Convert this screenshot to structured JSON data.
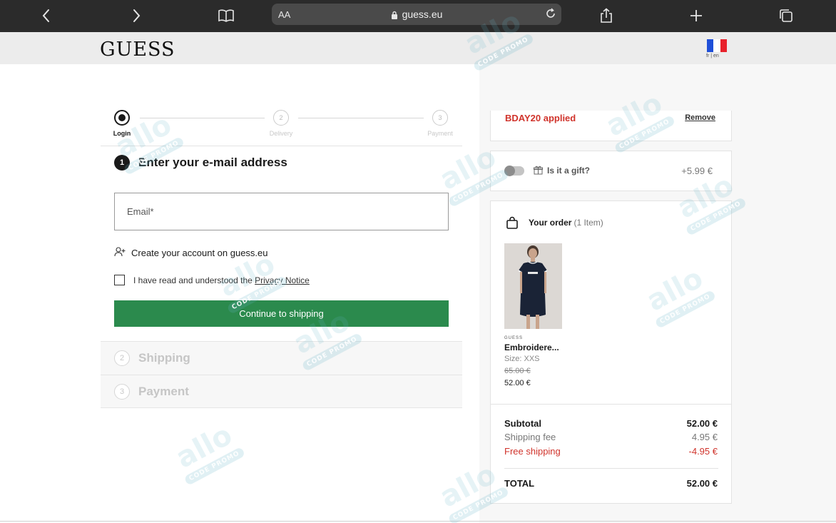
{
  "browser": {
    "aa_label": "AA",
    "url": "guess.eu"
  },
  "header": {
    "logo": "GUESS",
    "flag_colors": [
      "#1f4fd8",
      "#ffffff",
      "#e8212b"
    ],
    "language": "fr | en"
  },
  "stepper": {
    "steps": [
      {
        "number": "",
        "label": "Login"
      },
      {
        "number": "2",
        "label": "Delivery"
      },
      {
        "number": "3",
        "label": "Payment"
      }
    ]
  },
  "login": {
    "number": "1",
    "title": "Enter your e-mail address",
    "email_placeholder": "Email*",
    "create_account": "Create your account on guess.eu",
    "privacy_prefix": "I have read and understood the",
    "privacy_link": "Privacy Notice",
    "continue_label": "Continue to shipping",
    "continue_color": "#2b8a4d"
  },
  "sections": [
    {
      "number": "2",
      "title": "Shipping"
    },
    {
      "number": "3",
      "title": "Payment"
    }
  ],
  "promo": {
    "code_text": "BDAY20 applied",
    "remove_label": "Remove"
  },
  "gift": {
    "label": "Is it a gift?",
    "price": "+5.99 €"
  },
  "order": {
    "title": "Your order",
    "count": "(1 Item)",
    "product": {
      "brand": "GUESS",
      "name": "Embroidere...",
      "size": "Size: XXS",
      "old_price": "65.00 €",
      "new_price": "52.00 €"
    }
  },
  "totals": {
    "subtotal_label": "Subtotal",
    "subtotal_value": "52.00 €",
    "shipping_label": "Shipping fee",
    "shipping_value": "4.95 €",
    "free_label": "Free shipping",
    "free_value": "-4.95 €",
    "total_label": "TOTAL",
    "total_value": "52.00 €"
  },
  "watermark": {
    "word": "allo",
    "tag": "CODE PROMO"
  }
}
